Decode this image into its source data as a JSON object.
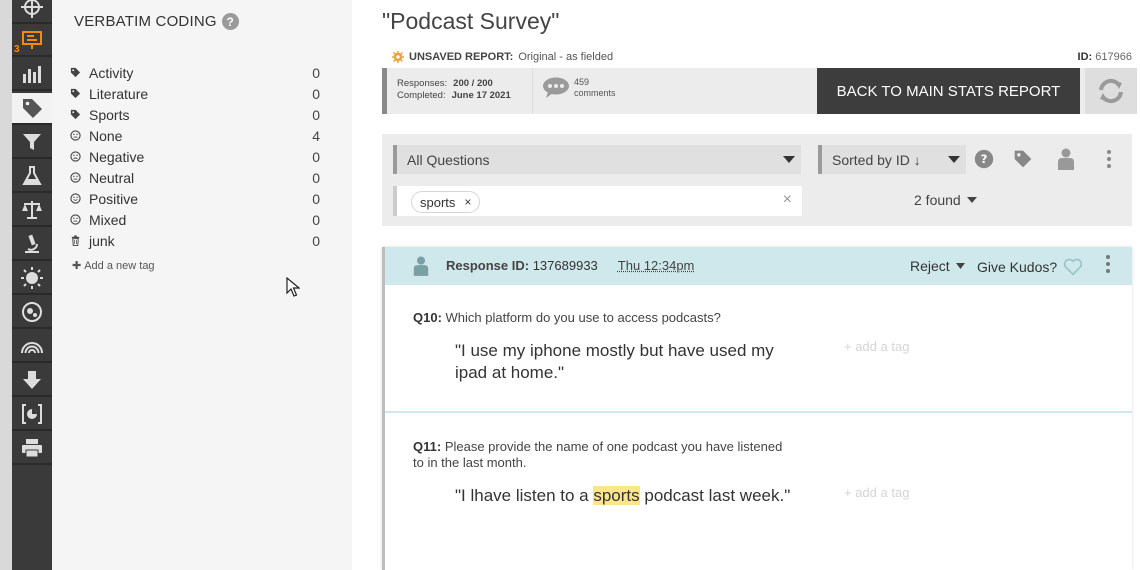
{
  "rail": {
    "badge": "3",
    "icons": [
      "crosshair-icon",
      "presentation-icon",
      "bar-chart-icon",
      "tag-icon",
      "filter-icon",
      "flask-icon",
      "scales-icon",
      "microscope-icon",
      "sun-icon",
      "segment-icon",
      "rainbow-icon",
      "download-icon",
      "bracket-chart-icon",
      "printer-icon"
    ]
  },
  "sidebar": {
    "title": "VERBATIM CODING",
    "help": "?",
    "tags": [
      {
        "icon": "tag-icon",
        "label": "Activity",
        "count": "0"
      },
      {
        "icon": "tag-icon",
        "label": "Literature",
        "count": "0"
      },
      {
        "icon": "tag-icon",
        "label": "Sports",
        "count": "0"
      },
      {
        "icon": "neutral-face-icon",
        "label": "None",
        "count": "4"
      },
      {
        "icon": "frown-face-icon",
        "label": "Negative",
        "count": "0"
      },
      {
        "icon": "neutral-face-icon",
        "label": "Neutral",
        "count": "0"
      },
      {
        "icon": "smile-face-icon",
        "label": "Positive",
        "count": "0"
      },
      {
        "icon": "neutral-face-icon",
        "label": "Mixed",
        "count": "0"
      },
      {
        "icon": "trash-icon",
        "label": "junk",
        "count": "0"
      }
    ],
    "add_tag": "Add a new tag"
  },
  "header": {
    "title": "\"Podcast Survey\"",
    "unsaved_label": "UNSAVED REPORT:",
    "unsaved_text": "Original - as fielded",
    "id_label": "ID:",
    "id_value": "617966"
  },
  "stats": {
    "responses_label": "Responses:",
    "responses_value": "200 / 200",
    "completed_label": "Completed:",
    "completed_value": "June 17 2021",
    "comments_count": "459",
    "comments_label": "comments",
    "back_button": "BACK TO MAIN STATS REPORT"
  },
  "filters": {
    "question_select": "All Questions",
    "sort_select": "Sorted by ID ↓",
    "search_chip": "sports",
    "chip_remove": "×",
    "search_clear": "×",
    "found": "2 found"
  },
  "response": {
    "id_label": "Response ID:",
    "id_value": "137689933",
    "time": "Thu 12:34pm",
    "reject": "Reject",
    "kudos": "Give Kudos?",
    "questions": [
      {
        "qnum": "Q10:",
        "qtext": "Which platform do you use to access podcasts?",
        "answer": "\"I use my iphone mostly but have used my ipad at home.\"",
        "add_tag": "+ add a tag"
      },
      {
        "qnum": "Q11:",
        "qtext": "Please provide the name of one podcast you have listened to in the last month.",
        "answer_before": "\"I lhave listen to a ",
        "answer_highlight": "sports",
        "answer_after": " podcast last week.\"",
        "add_tag": "+ add a tag"
      }
    ]
  },
  "colors": {
    "rail": "#3a3a3a",
    "accent_orange": "#ff8a00",
    "response_header": "#cfe8ec",
    "highlight": "#fce58a",
    "back_button": "#3d3d3d"
  }
}
